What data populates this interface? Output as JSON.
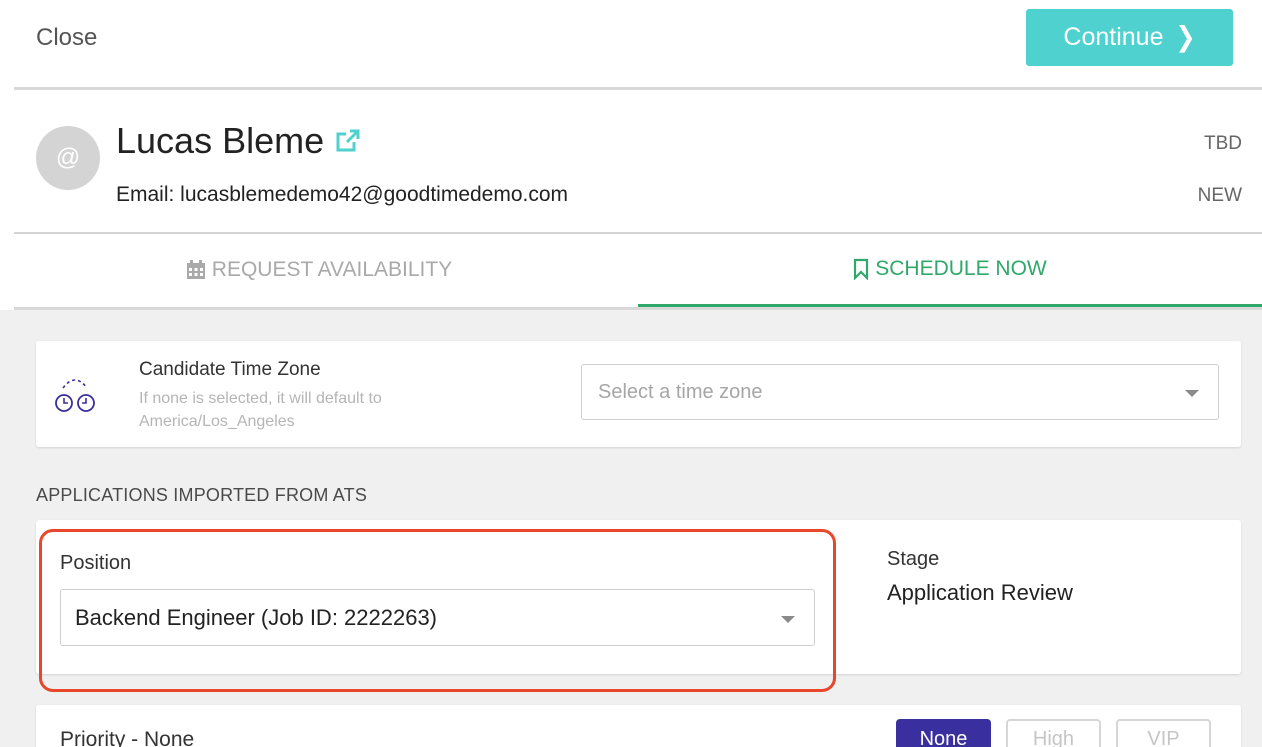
{
  "header": {
    "close_label": "Close",
    "continue_label": "Continue",
    "continue_icon": "chevron-right-icon"
  },
  "candidate": {
    "avatar_text": "@",
    "name": "Lucas Bleme",
    "name_icon": "external-link-icon",
    "email": "Email: lucasblemedemo42@goodtimedemo.com",
    "status_top": "TBD",
    "status_bottom": "NEW"
  },
  "tabs": [
    {
      "label": "REQUEST AVAILABILITY",
      "icon": "calendar-icon",
      "active": false
    },
    {
      "label": "SCHEDULE NOW",
      "icon": "bookmark-icon",
      "active": true
    }
  ],
  "timezone": {
    "title": "Candidate Time Zone",
    "help": "If none is selected, it will default to America/Los_Angeles",
    "placeholder": "Select a time zone",
    "icon": "two-clocks-icon"
  },
  "applications": {
    "heading": "APPLICATIONS IMPORTED FROM ATS",
    "position_label": "Position",
    "position_value": "Backend Engineer (Job ID: 2222263)",
    "stage_label": "Stage",
    "stage_value": "Application Review"
  },
  "priority": {
    "label": "Priority - None",
    "options": [
      "None",
      "High",
      "VIP"
    ],
    "selected": "None"
  },
  "colors": {
    "accent_teal": "#4fd2cf",
    "active_tab_green": "#2fa86a",
    "highlight_red": "#e8472c",
    "priority_selected": "#3a2f9e"
  }
}
